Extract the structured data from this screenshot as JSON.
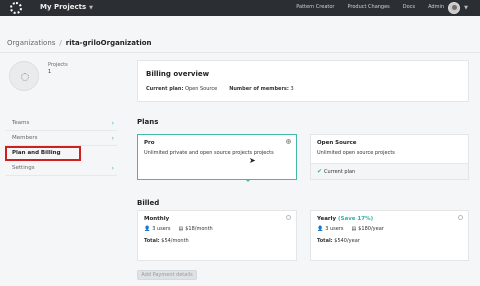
{
  "topbar": {
    "app_title": "My Projects",
    "nav": [
      "Pattern Creator",
      "Product Changes",
      "Docs",
      "Admin"
    ]
  },
  "breadcrumb": {
    "root": "Organizations",
    "sep": "/",
    "current": "rita-griloOrganization"
  },
  "org": {
    "projects_label": "Projects",
    "projects_count": "1"
  },
  "sidebar": {
    "items": [
      {
        "label": "Teams"
      },
      {
        "label": "Members"
      },
      {
        "label": "Plan and Billing"
      },
      {
        "label": "Settings"
      }
    ]
  },
  "overview": {
    "title": "Billing overview",
    "current_plan_label": "Current plan:",
    "current_plan_value": "Open Source",
    "members_label": "Number of members:",
    "members_value": "3"
  },
  "plans": {
    "title": "Plans",
    "pro": {
      "name": "Pro",
      "desc": "Unlimited private and open source projects projects"
    },
    "open_source": {
      "name": "Open Source",
      "desc": "Unlimited open source projects",
      "current": "Current plan"
    }
  },
  "billed": {
    "title": "Billed",
    "monthly": {
      "name": "Monthly",
      "users": "3 users",
      "price": "$18/month",
      "total_label": "Total:",
      "total_value": "$54/month"
    },
    "yearly": {
      "name": "Yearly",
      "save": "(Save 17%)",
      "users": "3 users",
      "price": "$180/year",
      "total_label": "Total:",
      "total_value": "$540/year"
    }
  },
  "payment_button": "Add Payment details",
  "colors": {
    "accent": "#2bb3a8",
    "highlight": "#d01f1f",
    "topbar": "#2b2f33"
  }
}
